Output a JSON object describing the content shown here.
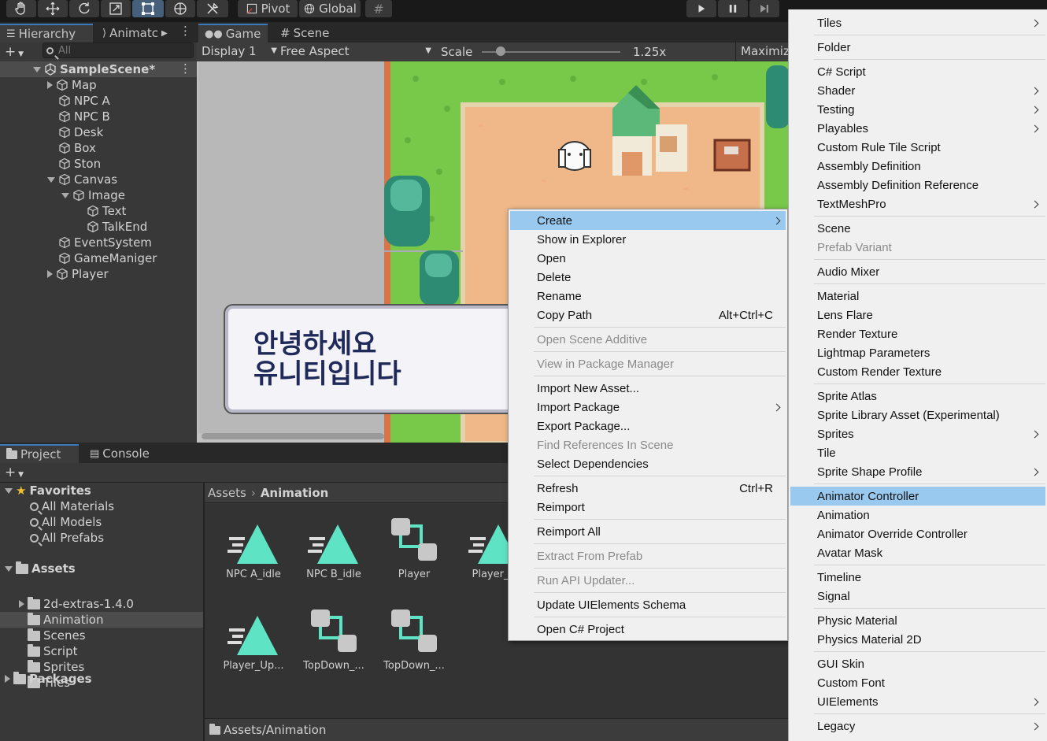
{
  "toolbar": {
    "pivot_label": "Pivot",
    "global_label": "Global"
  },
  "hierarchy": {
    "tab_label": "Hierarchy",
    "animator_tab_label": "Animatc",
    "search_placeholder": "All",
    "scene_name": "SampleScene*",
    "items": [
      "Map",
      "NPC A",
      "NPC B",
      "Desk",
      "Box",
      "Ston",
      "Canvas",
      "Image",
      "Text",
      "TalkEnd",
      "EventSystem",
      "GameManiger",
      "Player"
    ]
  },
  "game_view": {
    "game_tab_label": "Game",
    "scene_tab_label": "Scene",
    "display_label": "Display 1",
    "aspect_label": "Free Aspect",
    "scale_label": "Scale",
    "scale_value": "1.25x",
    "maximize_label": "Maximiz",
    "dialog_line1": "안녕하세요",
    "dialog_line2": "유니티입니다"
  },
  "project": {
    "project_tab_label": "Project",
    "console_tab_label": "Console",
    "favorites_label": "Favorites",
    "favorites": [
      "All Materials",
      "All Models",
      "All Prefabs"
    ],
    "assets_label": "Assets",
    "assets_folders": [
      "2d-extras-1.4.0",
      "Animation",
      "Scenes",
      "Script",
      "Sprites",
      "Tiles"
    ],
    "packages_label": "Packages",
    "breadcrumb_root": "Assets",
    "breadcrumb_current": "Animation",
    "assets_grid": [
      "NPC A_idle",
      "NPC B_idle",
      "Player",
      "Player_D",
      "Player_Up...",
      "TopDown_...",
      "TopDown_..."
    ],
    "footer_path": "Assets/Animation"
  },
  "context_menu": {
    "items": [
      {
        "label": "Create",
        "highlighted": true,
        "submenu": true
      },
      {
        "label": "Show in Explorer"
      },
      {
        "label": "Open"
      },
      {
        "label": "Delete"
      },
      {
        "label": "Rename"
      },
      {
        "label": "Copy Path",
        "shortcut": "Alt+Ctrl+C"
      },
      {
        "label": "Open Scene Additive",
        "disabled": true
      },
      {
        "label": "View in Package Manager",
        "disabled": true
      },
      {
        "label": "Import New Asset..."
      },
      {
        "label": "Import Package",
        "submenu": true
      },
      {
        "label": "Export Package..."
      },
      {
        "label": "Find References In Scene",
        "disabled": true
      },
      {
        "label": "Select Dependencies"
      },
      {
        "label": "Refresh",
        "shortcut": "Ctrl+R"
      },
      {
        "label": "Reimport"
      },
      {
        "label": "Reimport All"
      },
      {
        "label": "Extract From Prefab",
        "disabled": true
      },
      {
        "label": "Run API Updater...",
        "disabled": true
      },
      {
        "label": "Update UIElements Schema"
      },
      {
        "label": "Open C# Project"
      }
    ]
  },
  "create_submenu": {
    "items": [
      {
        "label": "Tiles",
        "submenu": true
      },
      {
        "label": "Folder"
      },
      {
        "label": "C# Script"
      },
      {
        "label": "Shader",
        "submenu": true
      },
      {
        "label": "Testing",
        "submenu": true
      },
      {
        "label": "Playables",
        "submenu": true
      },
      {
        "label": "Custom Rule Tile Script"
      },
      {
        "label": "Assembly Definition"
      },
      {
        "label": "Assembly Definition Reference"
      },
      {
        "label": "TextMeshPro",
        "submenu": true
      },
      {
        "label": "Scene"
      },
      {
        "label": "Prefab Variant",
        "disabled": true
      },
      {
        "label": "Audio Mixer"
      },
      {
        "label": "Material"
      },
      {
        "label": "Lens Flare"
      },
      {
        "label": "Render Texture"
      },
      {
        "label": "Lightmap Parameters"
      },
      {
        "label": "Custom Render Texture"
      },
      {
        "label": "Sprite Atlas"
      },
      {
        "label": "Sprite Library Asset (Experimental)"
      },
      {
        "label": "Sprites",
        "submenu": true
      },
      {
        "label": "Tile"
      },
      {
        "label": "Sprite Shape Profile",
        "submenu": true
      },
      {
        "label": "Animator Controller",
        "highlighted": true
      },
      {
        "label": "Animation"
      },
      {
        "label": "Animator Override Controller"
      },
      {
        "label": "Avatar Mask"
      },
      {
        "label": "Timeline"
      },
      {
        "label": "Signal"
      },
      {
        "label": "Physic Material"
      },
      {
        "label": "Physics Material 2D"
      },
      {
        "label": "GUI Skin"
      },
      {
        "label": "Custom Font"
      },
      {
        "label": "UIElements",
        "submenu": true
      },
      {
        "label": "Legacy",
        "submenu": true
      }
    ]
  },
  "colors": {
    "accent": "#99c9ef",
    "anim_clip": "#5fe3c5",
    "panel_bg": "#383838"
  }
}
